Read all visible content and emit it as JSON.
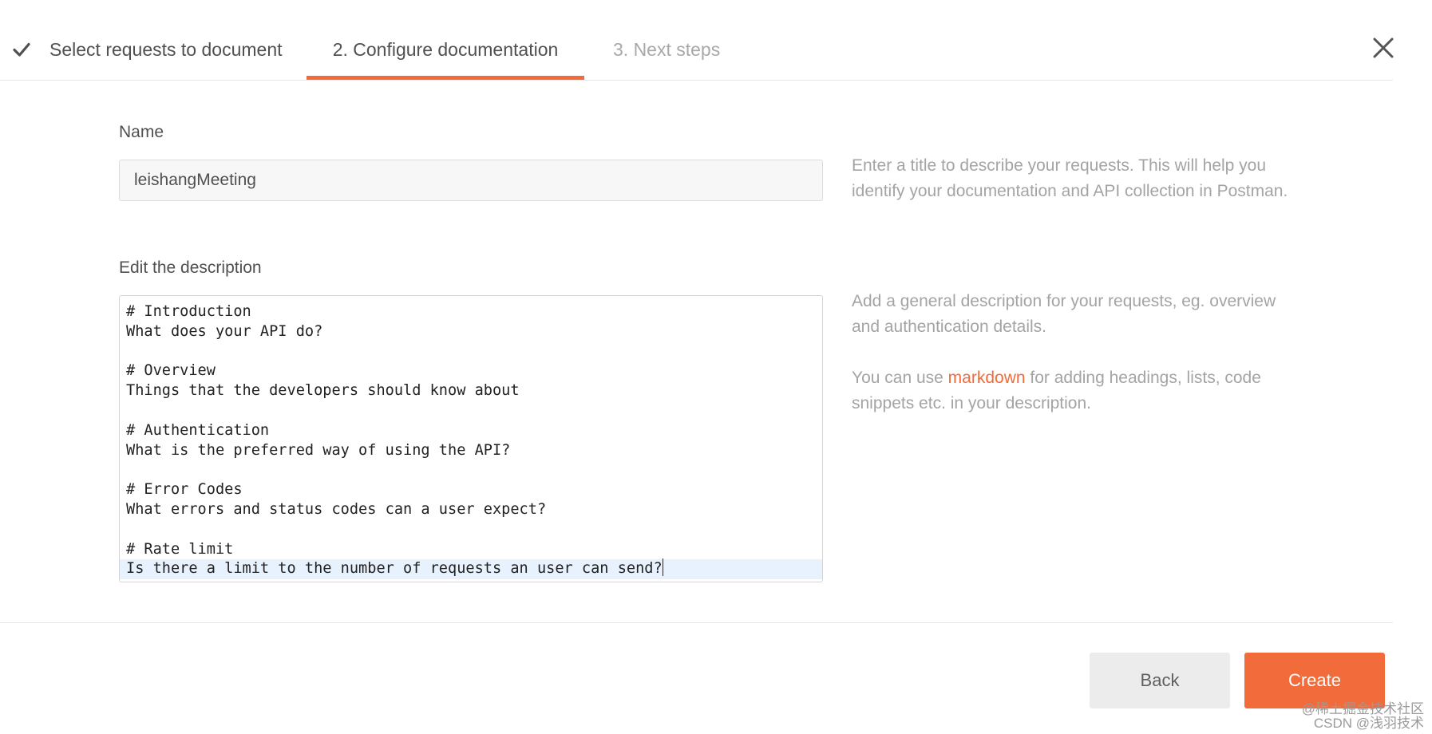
{
  "steps": {
    "step1": "Select requests to document",
    "step2": "2. Configure documentation",
    "step3": "3. Next steps"
  },
  "form": {
    "name_label": "Name",
    "name_value": "leishangMeeting",
    "description_label": "Edit the description",
    "description_lines": [
      "# Introduction",
      "What does your API do?",
      "",
      "# Overview",
      "Things that the developers should know about",
      "",
      "# Authentication",
      "What is the preferred way of using the API?",
      "",
      "# Error Codes",
      "What errors and status codes can a user expect?",
      "",
      "# Rate limit",
      "Is there a limit to the number of requests an user can send?"
    ]
  },
  "help": {
    "name_help": "Enter a title to describe your requests. This will help you identify your documentation and API collection in Postman.",
    "description_help": "Add a general description for your requests, eg. overview and authentication details.",
    "markdown_prefix": "You can use ",
    "markdown_link": "markdown",
    "markdown_suffix": " for adding headings, lists, code snippets etc. in your description."
  },
  "buttons": {
    "back": "Back",
    "create": "Create"
  },
  "watermark": {
    "line1": "@稀土掘金技术社区",
    "line2": "CSDN @浅羽技术"
  },
  "colors": {
    "accent": "#f26b3a",
    "help_text": "#a4a4a4",
    "active_line": "#e8f2fe"
  },
  "icons": {
    "step1": "checkmark-icon",
    "close": "close-icon"
  }
}
